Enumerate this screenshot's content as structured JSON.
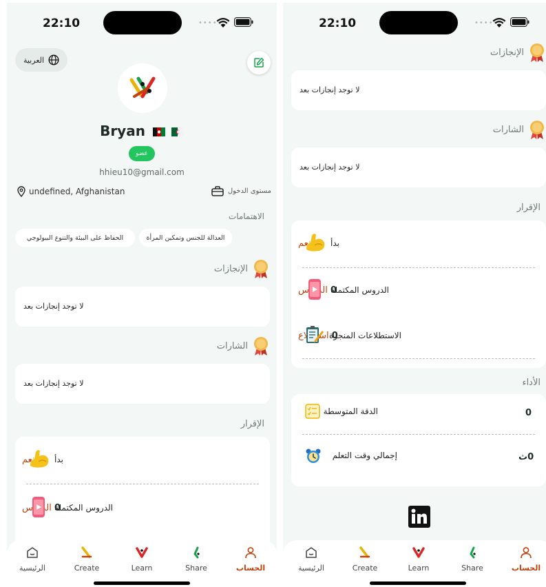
{
  "status": {
    "time": "22:10"
  },
  "left": {
    "language_label": "العربية",
    "profile": {
      "name": "Bryan",
      "badge": "عضو",
      "email": "hhieu10@gmail.com",
      "location": "undefined, Afghanistan",
      "level_label": "مستوى الدخول"
    },
    "interests": {
      "title": "الاهتمامات",
      "items": [
        "العدالة للجنس وتمكين المرأة",
        "الحفاظ على البيئة والتنوع البيولوجي"
      ]
    },
    "achievements": {
      "title": "الإنجازات",
      "empty": "لا توجد إنجازات بعد"
    },
    "badges": {
      "title": "الشارات",
      "empty": "لا توجد إنجازات بعد"
    },
    "acknowledgement": {
      "title": "الإقرار",
      "rows": [
        {
          "label": "بدأ",
          "value": "نعم",
          "icon": "flexed-arm-icon"
        },
        {
          "label": "الدروس المكتملة",
          "value_num": "0",
          "value_unit": "الدروس",
          "icon": "phone-video-icon"
        }
      ]
    }
  },
  "right": {
    "achievements": {
      "title": "الإنجازات",
      "empty": "لا توجد إنجازات بعد"
    },
    "badges": {
      "title": "الشارات",
      "empty": "لا توجد إنجازات بعد"
    },
    "acknowledgement": {
      "title": "الإقرار",
      "rows": [
        {
          "label": "بدأ",
          "value": "نعم",
          "icon": "flexed-arm-icon"
        },
        {
          "label": "الدروس المكتملة",
          "value_num": "0",
          "value_unit": "الدروس",
          "icon": "phone-video-icon"
        },
        {
          "label": "الاستطلاعات المنجزة",
          "value_num": "0",
          "value_unit": "استطلاع",
          "icon": "clipboard-survey-icon"
        }
      ]
    },
    "performance": {
      "title": "الأداء",
      "rows": [
        {
          "label": "الدقة المتوسطة",
          "value": "0",
          "icon": "checklist-icon"
        },
        {
          "label": "إجمالي وقت التعلم",
          "value": "0ث",
          "icon": "alarm-clock-icon"
        }
      ]
    },
    "social": {
      "icon": "linkedin-icon"
    }
  },
  "nav": {
    "items": [
      {
        "label": "الرئيسية",
        "icon": "home-icon",
        "active": false
      },
      {
        "label": "Create",
        "icon": "create-icon",
        "active": false
      },
      {
        "label": "Learn",
        "icon": "learn-icon",
        "active": false
      },
      {
        "label": "Share",
        "icon": "share-icon",
        "active": false
      },
      {
        "label": "الحساب",
        "icon": "account-icon",
        "active": true
      }
    ]
  },
  "colors": {
    "accent": "#c2410c",
    "badge_green": "#22c55e",
    "background": "#f3f8f6"
  }
}
